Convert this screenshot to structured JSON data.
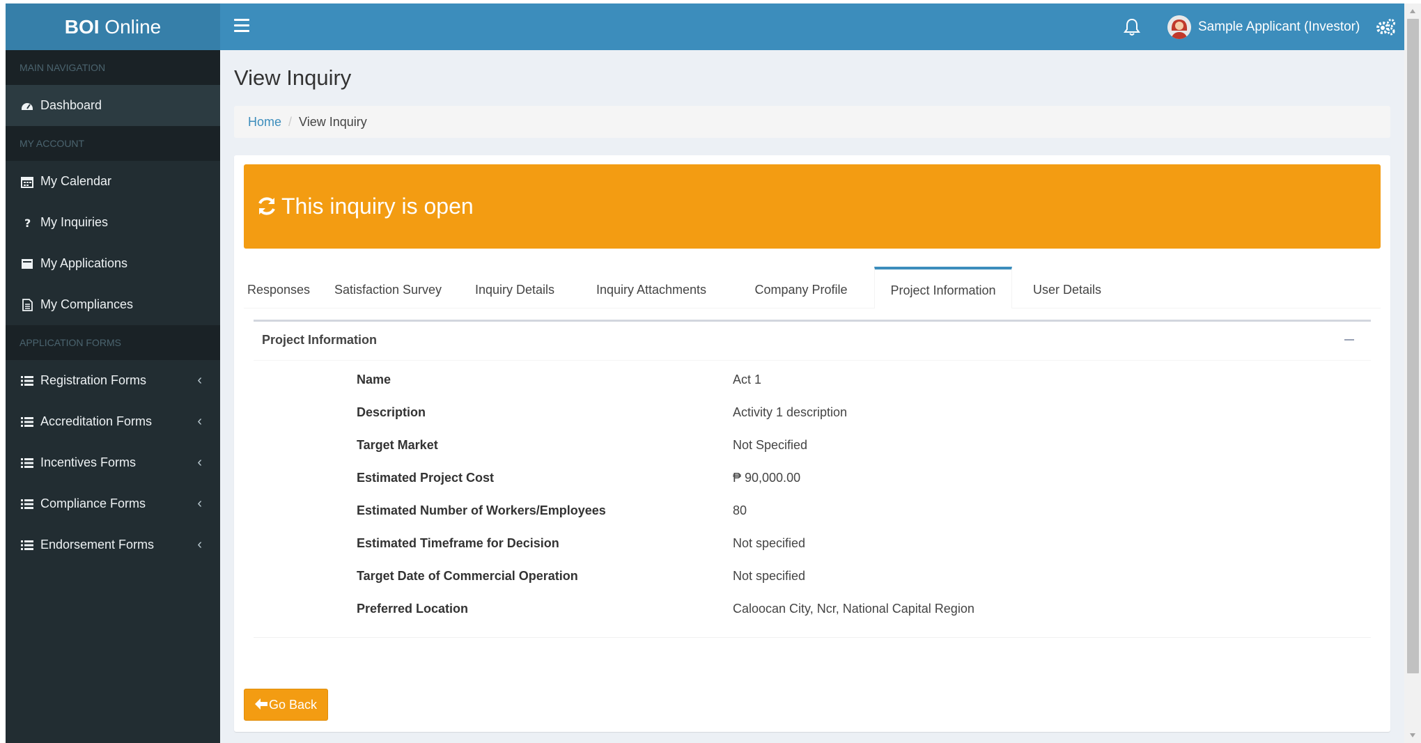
{
  "header": {
    "logo_bold": "BOI",
    "logo_rest": " Online",
    "user_name": "Sample Applicant (Investor)",
    "colors": {
      "header": "#3c8dbc",
      "logo_bg": "#367fa9"
    }
  },
  "sidebar": {
    "sections": {
      "main": "MAIN NAVIGATION",
      "account": "MY ACCOUNT",
      "forms": "APPLICATION FORMS"
    },
    "items": {
      "dashboard": {
        "label": "Dashboard",
        "icon": "dashboard-icon"
      },
      "calendar": {
        "label": "My Calendar",
        "icon": "calendar-icon"
      },
      "inquiries": {
        "label": "My Inquiries",
        "icon": "question-icon"
      },
      "applications": {
        "label": "My Applications",
        "icon": "applications-icon"
      },
      "compliances": {
        "label": "My Compliances",
        "icon": "document-icon"
      },
      "registration": {
        "label": "Registration Forms",
        "icon": "list-icon"
      },
      "accreditation": {
        "label": "Accreditation Forms",
        "icon": "list-icon"
      },
      "incentives": {
        "label": "Incentives Forms",
        "icon": "list-icon"
      },
      "compliance_forms": {
        "label": "Compliance Forms",
        "icon": "list-icon"
      },
      "endorsement": {
        "label": "Endorsement Forms",
        "icon": "list-icon"
      }
    },
    "chevron": "‹"
  },
  "page": {
    "title": "View Inquiry",
    "breadcrumb": {
      "home": "Home",
      "separator": "/",
      "current": "View Inquiry"
    },
    "status_banner": "This inquiry is open",
    "status_color": "#f39c12",
    "tabs": {
      "responses": "Responses",
      "survey": "Satisfaction Survey",
      "details": "Inquiry Details",
      "attachments": "Inquiry Attachments",
      "company": "Company Profile",
      "project": "Project Information",
      "user": "User Details"
    },
    "active_tab": "Project Information",
    "panel_title": "Project Information",
    "fields": {
      "name": {
        "label": "Name",
        "value": "Act 1"
      },
      "description": {
        "label": "Description",
        "value": "Activity 1 description"
      },
      "target_market": {
        "label": "Target Market",
        "value": "Not Specified"
      },
      "cost": {
        "label": "Estimated Project Cost",
        "value": "₱ 90,000.00"
      },
      "workers": {
        "label": "Estimated Number of Workers/Employees",
        "value": "80"
      },
      "timeframe": {
        "label": "Estimated Timeframe for Decision",
        "value": "Not specified"
      },
      "target_date": {
        "label": "Target Date of Commercial Operation",
        "value": "Not specified"
      },
      "location": {
        "label": "Preferred Location",
        "value": "Caloocan City, Ncr, National Capital Region"
      }
    },
    "back_button": "Go Back"
  }
}
